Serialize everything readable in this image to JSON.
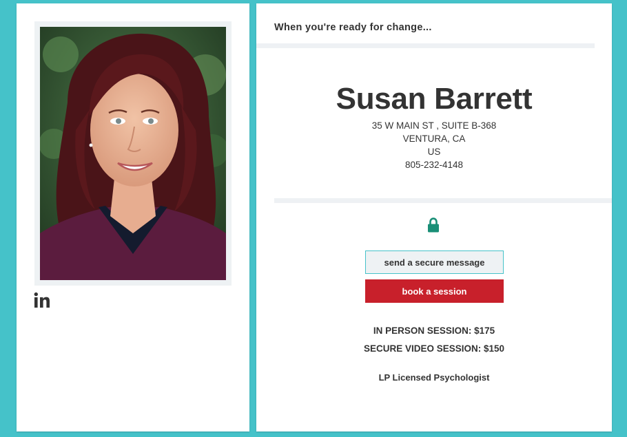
{
  "profile": {
    "photo_alt": "Susan Barrett",
    "linkedin_icon": "linkedin-icon"
  },
  "header": {
    "tagline": "When you're ready for change..."
  },
  "therapist": {
    "name": "Susan Barrett",
    "address_line1": "35 W MAIN ST , SUITE B-368",
    "address_line2": "VENTURA, CA",
    "country": "US",
    "phone": "805-232-4148"
  },
  "actions": {
    "lock_icon": "lock-icon",
    "secure_message_label": "send a secure message",
    "book_session_label": "book a session"
  },
  "fees": {
    "in_person": "IN PERSON SESSION: $175",
    "video": "SECURE VIDEO SESSION: $150"
  },
  "credential": "LP Licensed Psychologist",
  "colors": {
    "background": "#45c2c9",
    "accent_teal": "#1a8f77",
    "book_button": "#c8202b",
    "text": "#333333"
  }
}
